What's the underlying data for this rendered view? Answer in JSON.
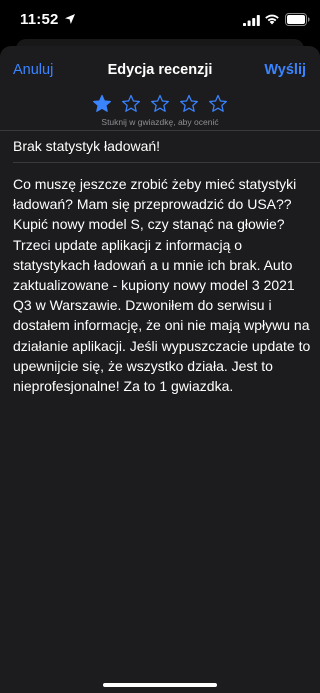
{
  "status_bar": {
    "time": "11:52",
    "icons": [
      "location-arrow-icon",
      "cellular-signal-icon",
      "wifi-icon",
      "battery-icon"
    ]
  },
  "nav": {
    "cancel_label": "Anuluj",
    "title": "Edycja recenzji",
    "send_label": "Wyślij"
  },
  "rating": {
    "value": 1,
    "max": 5,
    "hint": "Stuknij w gwiazdkę, aby ocenić",
    "filled_color": "#3a84ff",
    "empty_color": "#3a84ff"
  },
  "review": {
    "title": "Brak statystyk ładowań!",
    "body": "Co muszę jeszcze zrobić żeby mieć statystyki ładowań? Mam się przeprowadzić do USA?? Kupić nowy model S, czy stanąć na głowie? Trzeci update aplikacji z informacją o statystykach ładowań a u mnie ich brak. Auto zaktualizowane - kupiony nowy model 3 2021 Q3 w Warszawie. Dzwoniłem do serwisu i dostałem informację, że oni nie mają wpływu na działanie aplikacji. Jeśli wypuszczacie update to upewnijcie się, że wszystko działa. Jest to nieprofesjonalne! Za to 1 gwiazdka."
  },
  "colors": {
    "background": "#000000",
    "sheet": "#1c1c1e",
    "accent": "#3a84ff",
    "secondary_text": "#8e8e93",
    "separator": "#3a3a3c"
  }
}
